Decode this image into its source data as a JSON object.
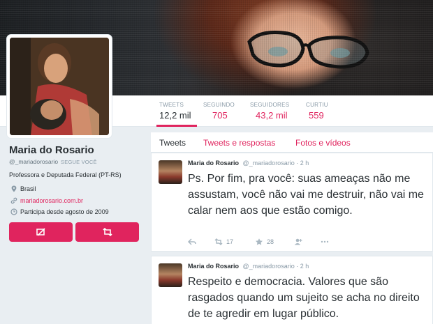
{
  "profile": {
    "name": "Maria do Rosario",
    "handle": "@_mariadorosario",
    "follows_you": "SEGUE VOCÊ",
    "bio": "Professora e Deputada Federal (PT-RS)",
    "location": "Brasil",
    "website": "mariadorosario.com.br",
    "joined": "Participa desde agosto de 2009"
  },
  "stats": [
    {
      "label": "TWEETS",
      "value": "12,2 mil"
    },
    {
      "label": "SEGUINDO",
      "value": "705"
    },
    {
      "label": "SEGUIDORES",
      "value": "43,2 mil"
    },
    {
      "label": "CURTIU",
      "value": "559"
    }
  ],
  "tabs": [
    "Tweets",
    "Tweets e respostas",
    "Fotos e vídeos"
  ],
  "tweets": [
    {
      "name": "Maria do Rosario",
      "handle": "@_mariadorosario",
      "time": "· 2 h",
      "text": "Ps. Por fim, pra você: suas ameaças não me assustam, você não vai me destruir, não vai me calar nem aos que estão comigo.",
      "retweets": "17",
      "likes": "28"
    },
    {
      "name": "Maria do Rosario",
      "handle": "@_mariadorosario",
      "time": "· 2 h",
      "text": "Respeito e democracia. Valores que são rasgados quando um sujeito se acha no direito de te agredir em lugar público."
    }
  ],
  "colors": {
    "accent": "#e0245e",
    "background": "#e9eef2"
  }
}
